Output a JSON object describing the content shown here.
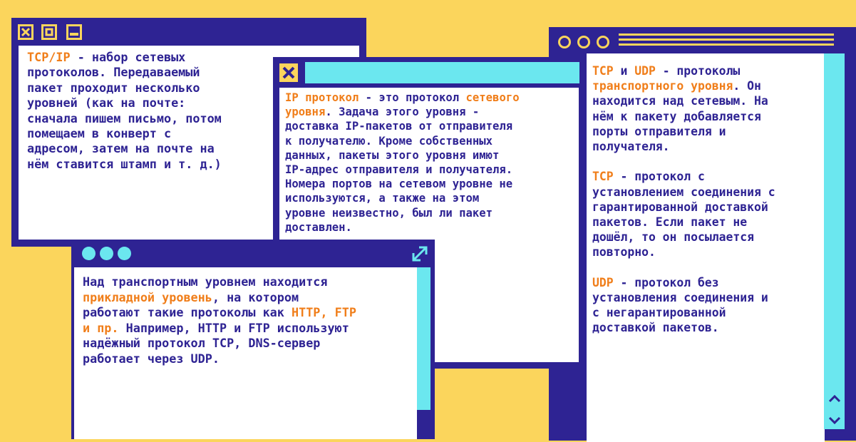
{
  "windows": {
    "tcpip": {
      "segments": [
        {
          "text": "TCP/IP",
          "hl": true
        },
        {
          "text": " - набор сетевых\nпротоколов. Передаваемый\nпакет проходит несколько\nуровней (как на почте:\nсначала пишем письмо, потом\nпомещаем в конверт с\nадресом, затем на почте на\nнём ставится штамп и т. д.)",
          "hl": false
        }
      ]
    },
    "ip": {
      "segments": [
        {
          "text": "IP протокол",
          "hl": true
        },
        {
          "text": " - это протокол ",
          "hl": false
        },
        {
          "text": "сетевого\nуровня",
          "hl": true
        },
        {
          "text": ". Задача этого уровня -\nдоставка IP-пакетов от отправителя\nк получателю. Кроме собственных\nданных, пакеты этого уровня имют\nIP-адрес отправителя и получателя.\nНомера портов на сетевом уровне не\nиспользуются, а также на этом\nуровне неизвестно, был ли пакет\nдоставлен.",
          "hl": false
        }
      ]
    },
    "transport": {
      "paragraphs": [
        [
          {
            "text": "TCP",
            "hl": true
          },
          {
            "text": " и ",
            "hl": false
          },
          {
            "text": "UDP",
            "hl": true
          },
          {
            "text": " - протоколы\n",
            "hl": false
          },
          {
            "text": "транспортного уровня",
            "hl": true
          },
          {
            "text": ". Он\nнаходится над сетевым. На\nнём к пакету добавляется\nпорты отправителя и\nполучателя.",
            "hl": false
          }
        ],
        [
          {
            "text": "TCP",
            "hl": true
          },
          {
            "text": " - протокол с\nустановлением соединения с\nгарантированной доставкой\nпакетов. Если пакет не\nдошёл, то он посылается\nповторно.",
            "hl": false
          }
        ],
        [
          {
            "text": "UDP",
            "hl": true
          },
          {
            "text": " - протокол без\nустановления соединения и\nс негарантированной\nдоставкой пакетов.",
            "hl": false
          }
        ]
      ]
    },
    "application": {
      "segments": [
        {
          "text": "Над транспортным уровнем находится\n",
          "hl": false
        },
        {
          "text": "прикладной уровень",
          "hl": true
        },
        {
          "text": ", на котором\nработают такие протоколы как ",
          "hl": false
        },
        {
          "text": "HTTP, FTP\nи пр.",
          "hl": true
        },
        {
          "text": " Например, HTTP и FTP используют\nнадёжный протокол TCP, DNS-сервер\nработает через UDP.",
          "hl": false
        }
      ]
    }
  },
  "icons": {
    "close": "close-icon",
    "maximize": "maximize-icon",
    "minimize": "minimize-icon",
    "expand": "expand-icon",
    "scroll_up": "chevron-up-icon",
    "scroll_down": "chevron-down-icon"
  },
  "colors": {
    "background": "#FBD55C",
    "frame": "#2E2393",
    "accent": "#6BE7EF",
    "highlight": "#F07E1A",
    "text": "#2E2393",
    "panel": "#FFFFFF"
  }
}
